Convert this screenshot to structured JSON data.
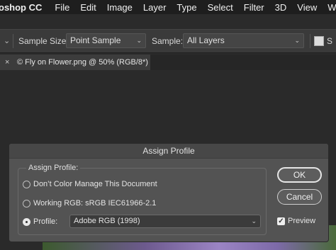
{
  "menubar": {
    "app": "oshop CC",
    "items": [
      "File",
      "Edit",
      "Image",
      "Layer",
      "Type",
      "Select",
      "Filter",
      "3D",
      "View",
      "Win"
    ]
  },
  "options": {
    "sample_size_label": "Sample Size:",
    "sample_size_value": "Point Sample",
    "sample_label": "Sample:",
    "sample_value": "All Layers",
    "cut_label": "S"
  },
  "tab": {
    "close": "×",
    "title": "© Fly on Flower.png @ 50% (RGB/8*)"
  },
  "dialog": {
    "title": "Assign Profile",
    "group_label": "Assign Profile:",
    "opt_no_manage": "Don’t Color Manage This Document",
    "opt_working": "Working RGB:  sRGB IEC61966-2.1",
    "opt_profile": "Profile:",
    "profile_value": "Adobe RGB (1998)",
    "ok": "OK",
    "cancel": "Cancel",
    "preview": "Preview",
    "preview_checked": true,
    "selected": "profile"
  }
}
